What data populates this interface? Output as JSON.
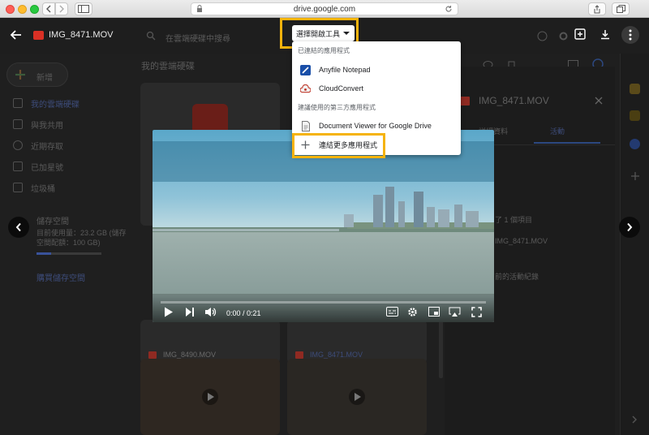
{
  "browser": {
    "url": "drive.google.com"
  },
  "viewer": {
    "filename": "IMG_8471.MOV"
  },
  "drive": {
    "new_label": "新增",
    "my_drive_header": "我的雲端硬碟",
    "search_placeholder": "在雲端硬碟中搜尋",
    "sidebar": [
      {
        "label": "我的雲端硬碟",
        "icon": "drive-icon"
      },
      {
        "label": "與我共用",
        "icon": "people-icon"
      },
      {
        "label": "近期存取",
        "icon": "clock-icon"
      },
      {
        "label": "已加星號",
        "icon": "star-icon"
      },
      {
        "label": "垃圾桶",
        "icon": "trash-icon"
      }
    ],
    "storage_label": "儲存空間",
    "storage_usage_line1": "目前使用量：23.2 GB (儲存",
    "storage_usage_line2": "空間配額：100 GB)",
    "storage_fill_fraction": 0.23,
    "buy_storage": "購買儲存空間",
    "files": [
      {
        "name": "IMG_8490.MOV"
      },
      {
        "name": "IMG_8471.MOV"
      }
    ],
    "details": {
      "title": "IMG_8471.MOV",
      "tab_details": "詳細資料",
      "tab_activity": "活動",
      "activity_line1": "了 1 個項目",
      "activity_file": "IMG_8471.MOV",
      "activity_line2": "前的活動紀錄"
    }
  },
  "video": {
    "time": "0:00 / 0:21",
    "progress_fraction": 0.0
  },
  "open_with": {
    "button_label": "選擇開啟工具",
    "section_connected": "已連結的應用程式",
    "section_suggested": "建議使用的第三方應用程式",
    "items": [
      {
        "label": "Anyfile Notepad",
        "icon": "anyfile-notepad-icon"
      },
      {
        "label": "CloudConvert",
        "icon": "cloudconvert-icon"
      },
      {
        "label": "Document Viewer for Google Drive",
        "icon": "document-viewer-icon"
      }
    ],
    "connect_more": "連結更多應用程式"
  },
  "colors": {
    "highlight": "#f5b30c",
    "progress": "#ff0000"
  }
}
